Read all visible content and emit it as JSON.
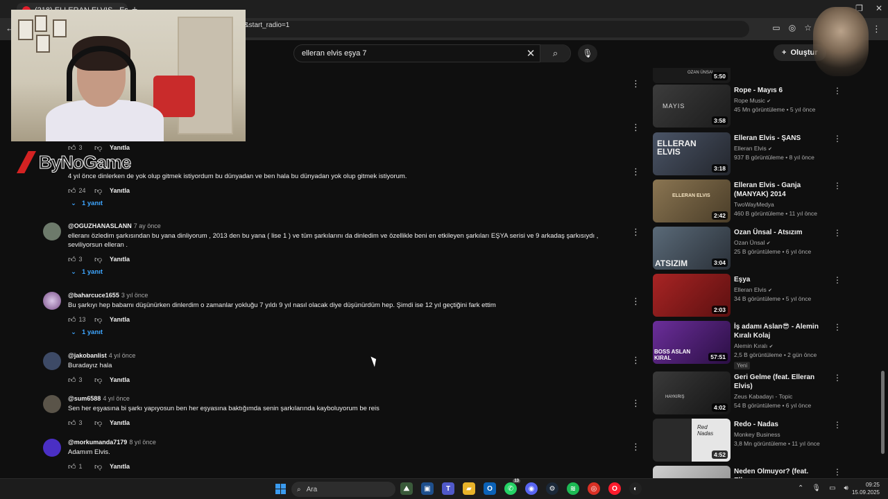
{
  "browser": {
    "tab_title": "(218) ELLERAN ELVIS - Eşy...",
    "new_tab": "+",
    "url": "&start_radio=1"
  },
  "youtube": {
    "search": {
      "value": "elleran elvis eşya 7",
      "placeholder": "Ara"
    },
    "create_label": "Oluştur"
  },
  "overlay": {
    "brand_name": "ByNoGame"
  },
  "comments": [
    {
      "author": "",
      "time": "",
      "text": "",
      "likes": "3",
      "reply_label": "Yanıtla",
      "replies": ""
    },
    {
      "author": "",
      "time": "",
      "text": "4 yıl önce dinlerken de yok olup gitmek istiyordum bu dünyadan ve ben hala bu dünyadan yok olup gitmek istiyorum.",
      "likes": "24",
      "reply_label": "Yanıtla",
      "replies": "1 yanıt"
    },
    {
      "author": "@OGUZHANASLANN",
      "time": "7 ay önce",
      "text": "elleranı özledim şarkısından bu yana dinliyorum , 2013 den bu yana ( lise 1 ) ve tüm şarkılarını da dinledim ve özellikle beni en etkileyen şarkıları EŞYA serisi ve 9 arkadaş şarkısıydı , seviliyorsun elleran .",
      "likes": "3",
      "reply_label": "Yanıtla",
      "replies": "1 yanıt"
    },
    {
      "author": "@baharcuce1655",
      "time": "3 yıl önce",
      "text": "Bu şarkıyı hep babamı düşünürken dinlerdim o zamanlar yokluğu 7 yıldı 9 yıl nasıl olacak diye düşünürdüm hep. Şimdi ise 12 yıl geçtiğini fark ettim",
      "likes": "13",
      "reply_label": "Yanıtla",
      "replies": "1 yanıt"
    },
    {
      "author": "@jakobanlist",
      "time": "4 yıl önce",
      "text": "Buradayız hala",
      "likes": "3",
      "reply_label": "Yanıtla",
      "replies": ""
    },
    {
      "author": "@sum6588",
      "time": "4 yıl önce",
      "text": "Sen her eşyasına bi şarkı yapıyosun ben her eşyasına baktığımda senin şarkılarında kayboluyorum be reis",
      "likes": "3",
      "reply_label": "Yanıtla",
      "replies": ""
    },
    {
      "author": "@morkumanda7179",
      "time": "8 yıl önce",
      "text": "Adamım Elvis.",
      "likes": "1",
      "reply_label": "Yanıtla",
      "replies": ""
    }
  ],
  "sidebar": [
    {
      "title": "",
      "channel": "",
      "stats": "",
      "duration": "5:50",
      "thumb_text": "OZAN ÜNSAL",
      "thumb_color": "#1a1a1a",
      "new": ""
    },
    {
      "title": "Rope - Mayıs 6",
      "channel": "Rope Music",
      "stats": "45 Mn görüntüleme • 5 yıl önce",
      "duration": "3:58",
      "thumb_text": "MAYIS",
      "thumb_color": "#2e2e2e",
      "new": ""
    },
    {
      "title": "Elleran Elvis - ŞANS",
      "channel": "Elleran Elvis",
      "stats": "937 B görüntüleme • 8 yıl önce",
      "duration": "3:18",
      "thumb_text": "ELLERAN ELVIS",
      "thumb_color": "#3b4250",
      "new": ""
    },
    {
      "title": "Elleran Elvis - Ganja  (MANYAK) 2014",
      "channel": "TwoWayMedya",
      "stats": "460 B görüntüleme • 11 yıl önce",
      "duration": "2:42",
      "thumb_text": "ELLERAN ELVIS",
      "thumb_color": "#6b5a3e",
      "new": ""
    },
    {
      "title": "Ozan Ünsal - Atsızım",
      "channel": "Ozan Ünsal",
      "stats": "25 B görüntüleme • 6 yıl önce",
      "duration": "3:04",
      "thumb_text": "ATSIZIM",
      "thumb_color": "#4a5560",
      "new": ""
    },
    {
      "title": "Eşya",
      "channel": "Elleran Elvis",
      "stats": "34 B görüntüleme • 5 yıl önce",
      "duration": "2:03",
      "thumb_text": "",
      "thumb_color": "#8a1f1f",
      "new": ""
    },
    {
      "title": "İş adamı Aslan😎 - Alemin Kıralı Kolaj",
      "channel": "Alemin Kıralı",
      "stats": "2,5 B görüntüleme • 2 gün önce",
      "duration": "57:51",
      "thumb_text": "BOSS ASLAN KIRAL",
      "thumb_color": "#4b1f6e",
      "new": "Yeni"
    },
    {
      "title": "Geri Gelme (feat. Elleran Elvis)",
      "channel": "Zeus Kabadayı - Topic",
      "stats": "54 B görüntüleme • 6 yıl önce",
      "duration": "4:02",
      "thumb_text": "HAYKIRIŞ",
      "thumb_color": "#2a2a2a",
      "new": ""
    },
    {
      "title": "Redo - Nadas",
      "channel": "Monkey Business",
      "stats": "3,8 Mn görüntüleme • 11 yıl önce",
      "duration": "4:52",
      "thumb_text": "Red Nadas",
      "thumb_color": "#dcdcdc",
      "new": ""
    },
    {
      "title": "Neden Olmuyor? (feat. Elleran",
      "channel": "",
      "stats": "",
      "duration": "",
      "thumb_text": "",
      "thumb_color": "#bbbbbb",
      "new": ""
    }
  ],
  "taskbar": {
    "search_label": "Ara",
    "whatsapp_badge": "13",
    "time": "09:25",
    "date": "15.09.2025"
  }
}
